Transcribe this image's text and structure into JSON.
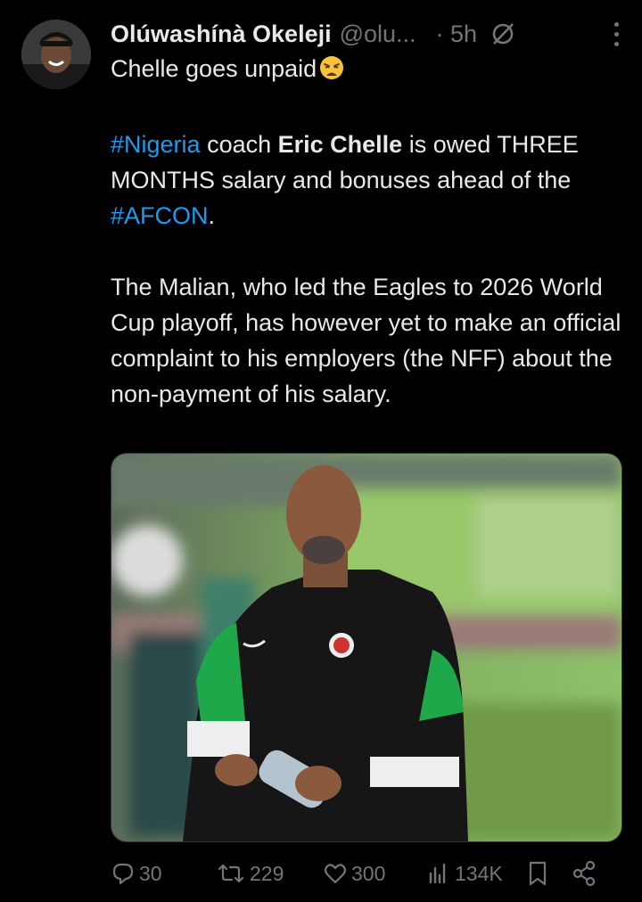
{
  "author": {
    "name": "Olúwashínà Okeleji",
    "handle": "@olu...",
    "time": "· 5h"
  },
  "tweet": {
    "line1": "Chelle goes unpaid",
    "p2": {
      "hashtag1": "#Nigeria",
      "t1": " coach ",
      "bold": "Eric Chelle",
      "t2": " is owed THREE MONTHS salary and bonuses ahead of the ",
      "hashtag2": "#AFCON",
      "t3": "."
    },
    "p3": "The Malian, who led the Eagles to 2026 World Cup playoff, has however yet to make an official complaint to his employers (the NFF) about the non-payment of his salary."
  },
  "actions": {
    "replies": "30",
    "reposts": "229",
    "likes": "300",
    "views": "134K"
  },
  "icons": [
    "grok-icon",
    "more-icon",
    "reply-icon",
    "repost-icon",
    "like-icon",
    "views-icon",
    "bookmark-icon",
    "share-icon",
    "weary-face-emoji"
  ],
  "colors": {
    "background": "#000000",
    "text": "#e7e9ea",
    "muted": "#71767b",
    "link": "#1d9bf0"
  }
}
